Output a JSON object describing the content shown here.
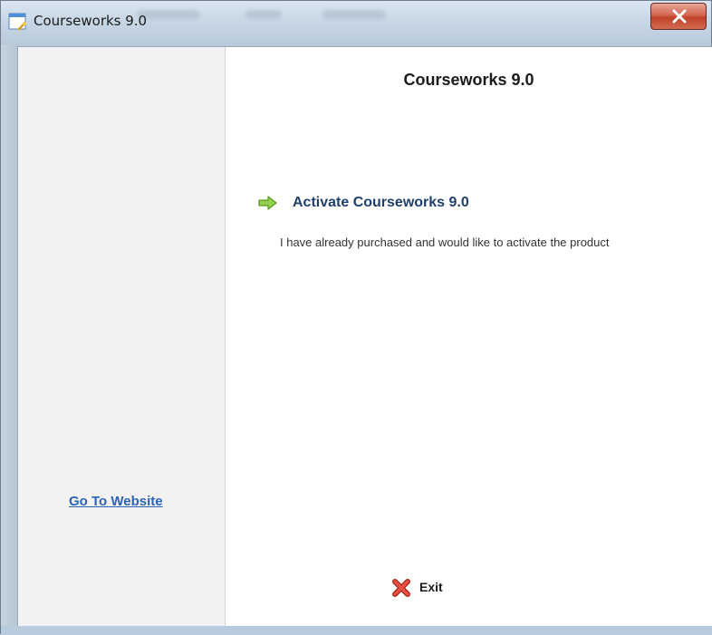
{
  "window": {
    "title": "Courseworks 9.0",
    "close_symbol": "X"
  },
  "sidebar": {
    "website_link": "Go To Website"
  },
  "main": {
    "title": "Courseworks 9.0",
    "activate": {
      "label": "Activate Courseworks 9.0",
      "description": "I have already purchased and would like to activate the product",
      "icon": "green-arrow-right-icon"
    },
    "exit": {
      "label": "Exit",
      "icon": "red-x-icon"
    }
  },
  "colors": {
    "link": "#2b63b5",
    "activate_label": "#1f3f6b",
    "arrow": "#7cc23a",
    "close_button": "#c04328"
  }
}
